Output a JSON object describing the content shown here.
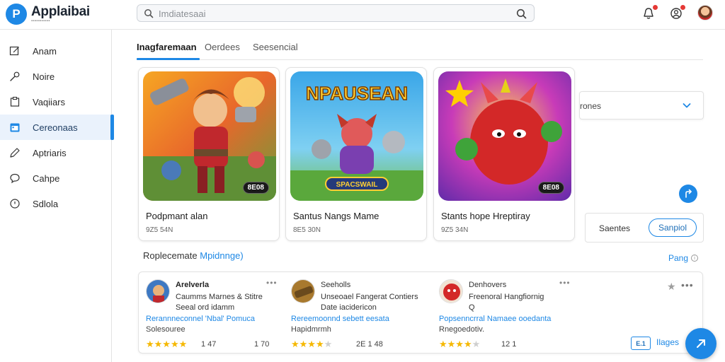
{
  "app": {
    "logo_letter": "P",
    "name": "Applaibai",
    "tagline": "▪▪▪▪▪▪▪▪▪▪▪"
  },
  "search": {
    "placeholder": "Imdiatesaai"
  },
  "sidebar": {
    "items": [
      {
        "label": "Anam",
        "icon": "pencil-square-icon"
      },
      {
        "label": "Noire",
        "icon": "wrench-icon"
      },
      {
        "label": "Vaqiiars",
        "icon": "clipboard-icon"
      },
      {
        "label": "Cereonaas",
        "icon": "calendar-icon",
        "active": true
      },
      {
        "label": "Aptriaris",
        "icon": "pencil-icon"
      },
      {
        "label": "Cahpe",
        "icon": "chat-icon"
      },
      {
        "label": "Sdlola",
        "icon": "clock-icon"
      }
    ]
  },
  "tabs": [
    {
      "label": "Inagfaremaan",
      "active": true
    },
    {
      "label": "Oerdees"
    },
    {
      "label": "Seesencial"
    }
  ],
  "cards": [
    {
      "title": "Podpmant alan",
      "meta": "9Z5 54N",
      "price": "8E08"
    },
    {
      "title": "Santus Nangs Mame",
      "meta": "8E5 30N",
      "price": "",
      "art_text_top": "NPAUSEAN",
      "art_text_banner": "SPACSWAIL"
    },
    {
      "title": "Stants hope Hreptiray",
      "meta": "9Z5 34N",
      "price": "8E08"
    }
  ],
  "dropdown": {
    "value": "rones"
  },
  "filter": {
    "label": "Saentes",
    "button": "Sanpiol"
  },
  "section": {
    "title": "Roplecemate",
    "link": "Mpidnnge)",
    "more": "Pang"
  },
  "list_items": [
    {
      "name": "Arelverla",
      "desc1": "Caumms Marnes & Stitre",
      "desc2": "Seeal ord idamm",
      "link": "Rerannneconnel 'Nbal' Pomuca",
      "sub": "Solesouree",
      "rating": 5,
      "count": "1 47"
    },
    {
      "name": "Seeholls",
      "desc1": "Unseoael Fangerat Contiers",
      "desc2": "Date iacidericon",
      "link": "Rereemoonnd sebett eesata",
      "sub": "Hapidmrmh",
      "rating": 4,
      "count": "2E 1 48"
    },
    {
      "name": "Denhovers",
      "desc1": "Freenoral Hangfiornig",
      "desc2": "Q",
      "link": "Popsenncrral Namaee ooedanta",
      "sub": "Rnegoedotiv.",
      "rating": 4,
      "count": "12 1"
    }
  ],
  "list_side_counts": [
    "1 70"
  ],
  "bottom": {
    "tag": "E.1",
    "link": "Ilages"
  },
  "colors": {
    "accent": "#1e88e5",
    "star": "#f5b800",
    "badge": "#e53935"
  }
}
